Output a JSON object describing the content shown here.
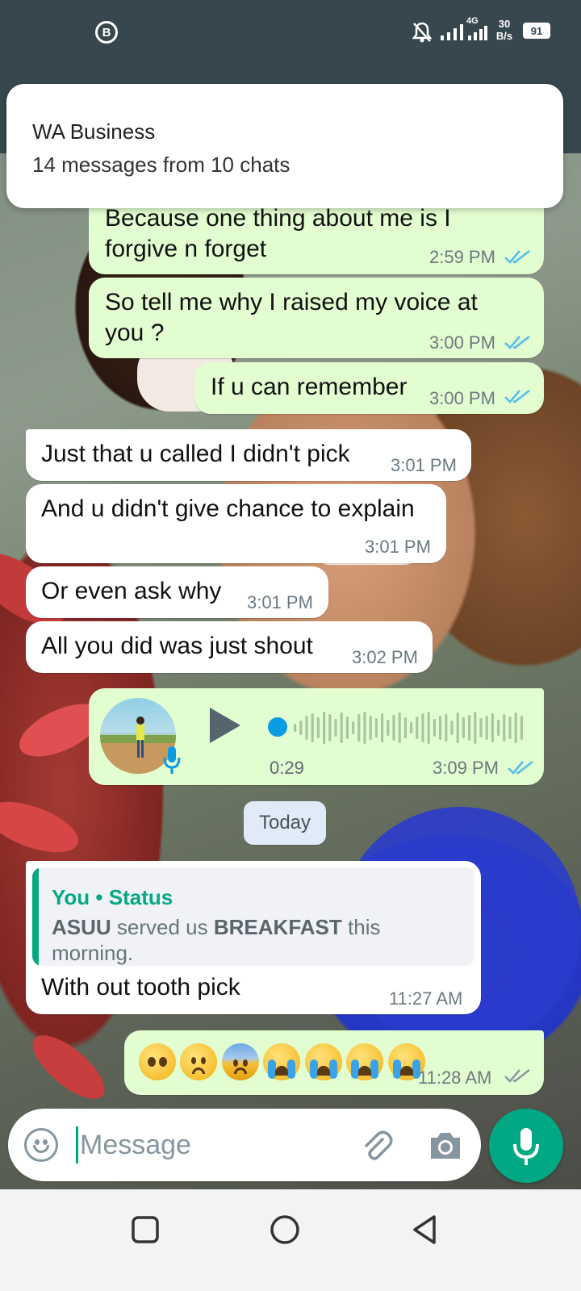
{
  "status_bar": {
    "network": "4G",
    "speed_value": "30",
    "speed_unit": "B/s",
    "battery": "91",
    "business_badge": "B"
  },
  "notification": {
    "title": "WA Business",
    "body": "14 messages from 10 chats"
  },
  "messages": [
    {
      "direction": "out",
      "text": "Because one thing about me is I forgive n forget",
      "time": "2:59 PM",
      "status": "read"
    },
    {
      "direction": "out",
      "text": "So tell me why I raised my voice at you ?",
      "time": "3:00 PM",
      "status": "read"
    },
    {
      "direction": "out",
      "text": "If u can remember",
      "time": "3:00 PM",
      "status": "read"
    },
    {
      "direction": "in",
      "text": "Just that u called I didn't pick",
      "time": "3:01 PM"
    },
    {
      "direction": "in",
      "text": "And u didn't give chance to explain",
      "time": "3:01 PM"
    },
    {
      "direction": "in",
      "text": "Or even ask why",
      "time": "3:01 PM"
    },
    {
      "direction": "in",
      "text": "All you did was just shout",
      "time": "3:02 PM"
    }
  ],
  "voice_note": {
    "duration": "0:29",
    "time": "3:09 PM",
    "status": "read",
    "progress": 0
  },
  "date_divider": "Today",
  "status_reply": {
    "quote_author": "You",
    "quote_separator": "•",
    "quote_source": "Status",
    "quote_bold_1": "ASUU",
    "quote_mid": "served us",
    "quote_bold_2": "BREAKFAST",
    "quote_tail": "this morning.",
    "text": "With out tooth pick",
    "time": "11:27 AM"
  },
  "emoji_message": {
    "emojis": [
      "pleading-face",
      "sad-face",
      "anxious-sweat-face",
      "crying-face",
      "crying-face",
      "crying-face",
      "crying-face"
    ],
    "time": "11:28 AM",
    "status": "delivered"
  },
  "composer": {
    "placeholder": "Message"
  },
  "colors": {
    "header": "#37474f",
    "outgoing_bubble": "#e2fdd0",
    "incoming_bubble": "#ffffff",
    "accent": "#00a884",
    "read_ticks": "#53bdeb"
  }
}
